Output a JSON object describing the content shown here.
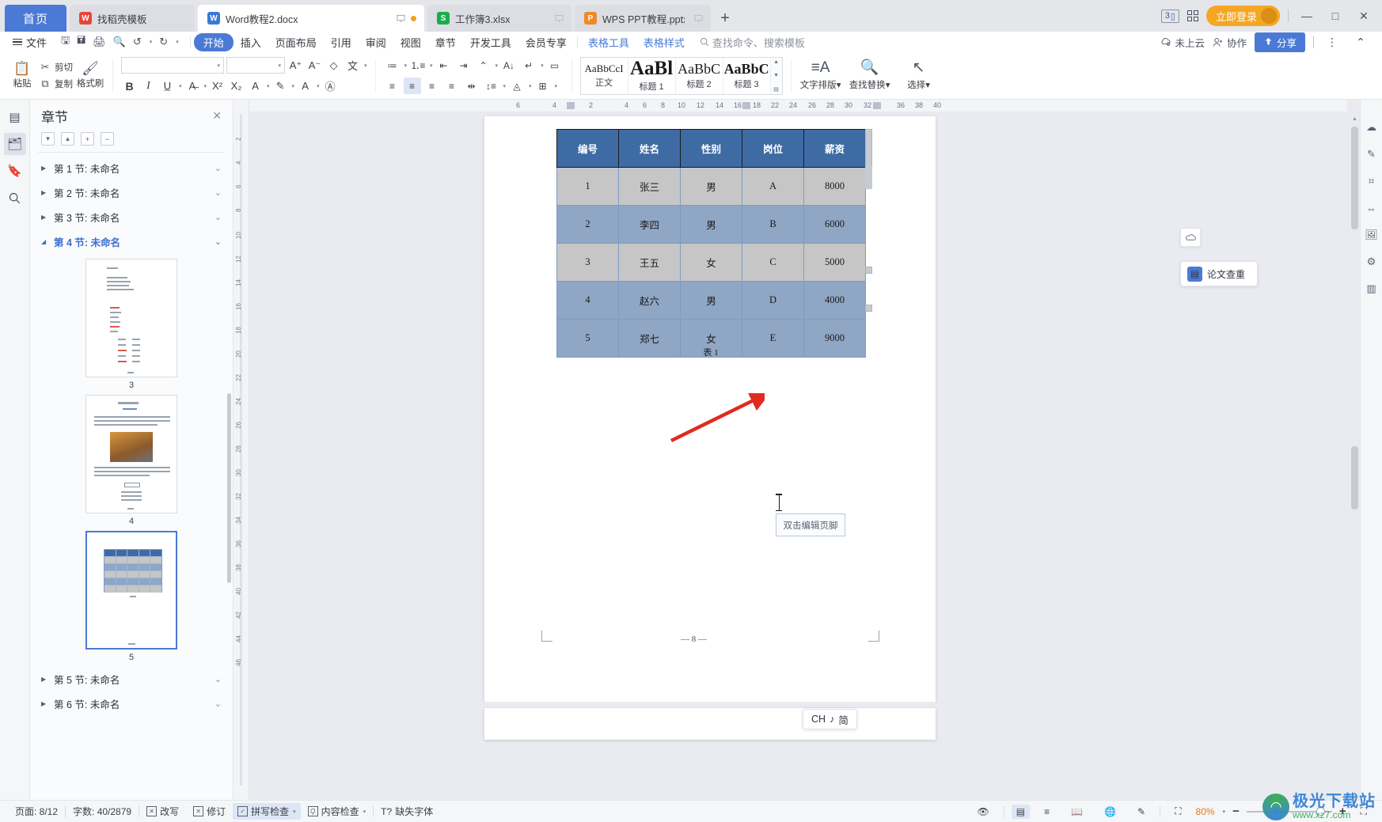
{
  "tabbar": {
    "home_label": "首页",
    "tabs": [
      {
        "label": "找稻壳模板",
        "icon": "wps-red-icon",
        "color": "red",
        "active": false,
        "width": "tab-w1"
      },
      {
        "label": "Word教程2.docx",
        "icon": "word-blue-icon",
        "color": "blue",
        "active": true,
        "width": ""
      },
      {
        "label": "工作簿3.xlsx",
        "icon": "excel-green-icon",
        "color": "green",
        "active": false,
        "width": "tab-w2"
      },
      {
        "label": "WPS PPT教程.pptx",
        "icon": "ppt-orange-icon",
        "color": "orange",
        "active": false,
        "width": "tab-w3"
      }
    ],
    "new_tab": "+",
    "badge_count": "3",
    "login_label": "立即登录",
    "window": {
      "minimize": "—",
      "maximize": "□",
      "close": "✕"
    }
  },
  "menubar": {
    "file_label": "文件",
    "quick_icons": [
      "save-icon",
      "save-as-icon",
      "print-icon",
      "print-preview-icon",
      "undo-icon",
      "redo-icon",
      "customize-icon"
    ],
    "items": [
      {
        "label": "开始",
        "active": true,
        "tool": false
      },
      {
        "label": "插入",
        "active": false,
        "tool": false
      },
      {
        "label": "页面布局",
        "active": false,
        "tool": false
      },
      {
        "label": "引用",
        "active": false,
        "tool": false
      },
      {
        "label": "审阅",
        "active": false,
        "tool": false
      },
      {
        "label": "视图",
        "active": false,
        "tool": false
      },
      {
        "label": "章节",
        "active": false,
        "tool": false
      },
      {
        "label": "开发工具",
        "active": false,
        "tool": false
      },
      {
        "label": "会员专享",
        "active": false,
        "tool": false
      },
      {
        "label": "表格工具",
        "active": false,
        "tool": true
      },
      {
        "label": "表格样式",
        "active": false,
        "tool": true
      }
    ],
    "search_placeholder": "查找命令、搜索模板",
    "cloud_label": "未上云",
    "collab_label": "协作",
    "share_label": "分享"
  },
  "ribbon": {
    "paste_label": "粘贴",
    "cut_label": "剪切",
    "copy_label": "复制",
    "format_painter_label": "格式刷",
    "font_name": "",
    "font_size": "",
    "styles": [
      {
        "preview": "AaBbCcI",
        "name": "正文",
        "size": "13px",
        "bold": false
      },
      {
        "preview": "AaBl",
        "name": "标题 1",
        "size": "26px",
        "bold": true
      },
      {
        "preview": "AaBbC",
        "name": "标题 2",
        "size": "19px",
        "bold": false
      },
      {
        "preview": "AaBbC",
        "name": "标题 3",
        "size": "19px",
        "bold": true
      }
    ],
    "text_layout_label": "文字排版",
    "find_replace_label": "查找替换",
    "select_label": "选择"
  },
  "panel": {
    "title": "章节",
    "tools": [
      "▾",
      "▴",
      "+",
      "−"
    ],
    "sections": [
      {
        "label": "第 1 节: 未命名",
        "selected": false,
        "expanded": false
      },
      {
        "label": "第 2 节: 未命名",
        "selected": false,
        "expanded": false
      },
      {
        "label": "第 3 节: 未命名",
        "selected": false,
        "expanded": false
      },
      {
        "label": "第 4 节: 未命名",
        "selected": true,
        "expanded": true
      }
    ],
    "sections_bottom": [
      {
        "label": "第 5 节: 未命名",
        "selected": false,
        "expanded": false
      },
      {
        "label": "第 6 节: 未命名",
        "selected": false,
        "expanded": false
      }
    ],
    "thumbnails": [
      {
        "number": "3",
        "selected": false
      },
      {
        "number": "4",
        "selected": false
      },
      {
        "number": "5",
        "selected": true
      }
    ]
  },
  "ruler": {
    "h_numbers": [
      "6",
      "4",
      "2",
      "2",
      "4",
      "6",
      "8",
      "10",
      "12",
      "14",
      "16",
      "18",
      "22",
      "24",
      "26",
      "28",
      "30",
      "32",
      "36",
      "38",
      "40"
    ],
    "v_numbers": [
      "2",
      "4",
      "6",
      "8",
      "10",
      "12",
      "14",
      "16",
      "18",
      "20",
      "22",
      "24",
      "26",
      "28",
      "30",
      "32",
      "34",
      "36",
      "38",
      "40",
      "42",
      "44",
      "46"
    ]
  },
  "document": {
    "table": {
      "headers": [
        "编号",
        "姓名",
        "性别",
        "岗位",
        "薪资"
      ],
      "rows": [
        [
          "1",
          "张三",
          "男",
          "A",
          "8000"
        ],
        [
          "2",
          "李四",
          "男",
          "B",
          "6000"
        ],
        [
          "3",
          "王五",
          "女",
          "C",
          "5000"
        ],
        [
          "4",
          "赵六",
          "男",
          "D",
          "4000"
        ],
        [
          "5",
          "郑七",
          "女",
          "E",
          "9000"
        ]
      ],
      "caption": "表 1",
      "header_bg": "#3f6ba4",
      "odd_bg": "#c6c6c6",
      "even_bg": "#8fa6c4"
    },
    "footer_hint": "双击编辑页脚",
    "page_marker": "— 8 —"
  },
  "float_widget": {
    "label": "论文查重",
    "icon": "document-check-icon"
  },
  "status": {
    "page_label": "页面: 8/12",
    "word_count": "字数: 40/2879",
    "overwrite": "改写",
    "revision": "修订",
    "spellcheck": "拼写检查",
    "content_check": "内容检查",
    "missing_font": "缺失字体",
    "view_icons": [
      "eye-icon",
      "page-view-icon",
      "outline-view-icon",
      "reading-view-icon",
      "web-view-icon",
      "edit-pen-icon"
    ],
    "zoom_level": "80%",
    "zoom_minus": "−",
    "zoom_plus": "+",
    "fullscreen": "fullscreen-icon"
  },
  "ime": {
    "lang": "CH",
    "mode_icon": "♪",
    "mode": "简"
  },
  "watermark": {
    "title": "极光下载站",
    "url": "www.xz7.com"
  }
}
